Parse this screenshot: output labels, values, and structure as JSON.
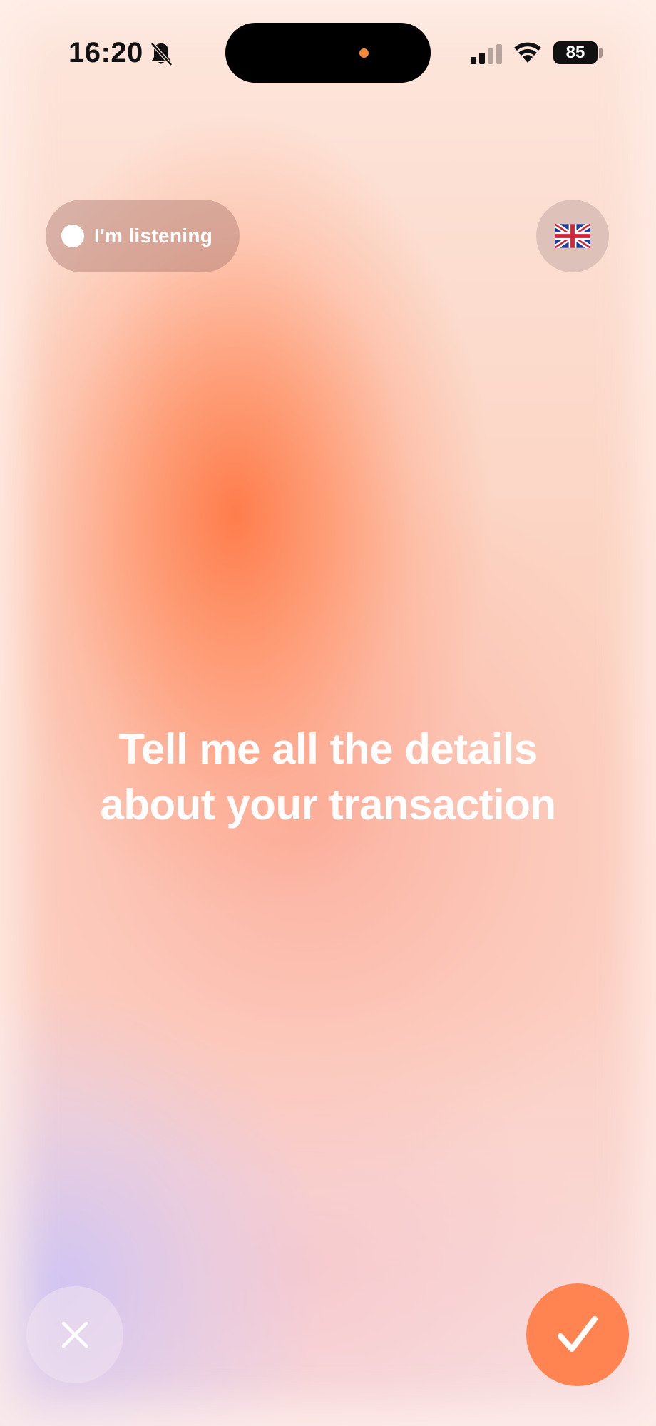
{
  "status_bar": {
    "time": "16:20",
    "battery_level": "85",
    "icons": [
      "bell-slash-icon",
      "cellular-signal-icon",
      "wifi-icon",
      "battery-icon"
    ]
  },
  "listening_indicator": {
    "label": "I'm listening"
  },
  "language_button": {
    "icon": "uk-flag-icon"
  },
  "prompt": {
    "line1": "Tell me all the details",
    "line2": "about your transaction"
  },
  "actions": {
    "cancel_icon": "close-icon",
    "confirm_icon": "checkmark-icon"
  },
  "colors": {
    "accent": "#ff8451",
    "island_dot": "#f58a3c"
  }
}
